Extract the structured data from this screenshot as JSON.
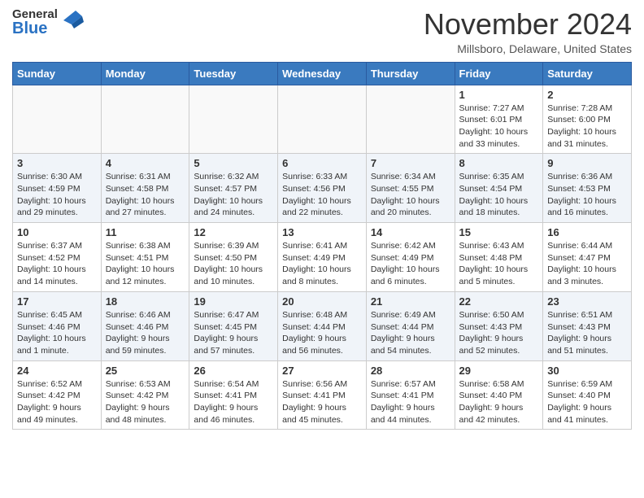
{
  "header": {
    "logo_general": "General",
    "logo_blue": "Blue",
    "month_title": "November 2024",
    "location": "Millsboro, Delaware, United States"
  },
  "days_of_week": [
    "Sunday",
    "Monday",
    "Tuesday",
    "Wednesday",
    "Thursday",
    "Friday",
    "Saturday"
  ],
  "weeks": [
    [
      {
        "day": "",
        "info": ""
      },
      {
        "day": "",
        "info": ""
      },
      {
        "day": "",
        "info": ""
      },
      {
        "day": "",
        "info": ""
      },
      {
        "day": "",
        "info": ""
      },
      {
        "day": "1",
        "info": "Sunrise: 7:27 AM\nSunset: 6:01 PM\nDaylight: 10 hours\nand 33 minutes."
      },
      {
        "day": "2",
        "info": "Sunrise: 7:28 AM\nSunset: 6:00 PM\nDaylight: 10 hours\nand 31 minutes."
      }
    ],
    [
      {
        "day": "3",
        "info": "Sunrise: 6:30 AM\nSunset: 4:59 PM\nDaylight: 10 hours\nand 29 minutes."
      },
      {
        "day": "4",
        "info": "Sunrise: 6:31 AM\nSunset: 4:58 PM\nDaylight: 10 hours\nand 27 minutes."
      },
      {
        "day": "5",
        "info": "Sunrise: 6:32 AM\nSunset: 4:57 PM\nDaylight: 10 hours\nand 24 minutes."
      },
      {
        "day": "6",
        "info": "Sunrise: 6:33 AM\nSunset: 4:56 PM\nDaylight: 10 hours\nand 22 minutes."
      },
      {
        "day": "7",
        "info": "Sunrise: 6:34 AM\nSunset: 4:55 PM\nDaylight: 10 hours\nand 20 minutes."
      },
      {
        "day": "8",
        "info": "Sunrise: 6:35 AM\nSunset: 4:54 PM\nDaylight: 10 hours\nand 18 minutes."
      },
      {
        "day": "9",
        "info": "Sunrise: 6:36 AM\nSunset: 4:53 PM\nDaylight: 10 hours\nand 16 minutes."
      }
    ],
    [
      {
        "day": "10",
        "info": "Sunrise: 6:37 AM\nSunset: 4:52 PM\nDaylight: 10 hours\nand 14 minutes."
      },
      {
        "day": "11",
        "info": "Sunrise: 6:38 AM\nSunset: 4:51 PM\nDaylight: 10 hours\nand 12 minutes."
      },
      {
        "day": "12",
        "info": "Sunrise: 6:39 AM\nSunset: 4:50 PM\nDaylight: 10 hours\nand 10 minutes."
      },
      {
        "day": "13",
        "info": "Sunrise: 6:41 AM\nSunset: 4:49 PM\nDaylight: 10 hours\nand 8 minutes."
      },
      {
        "day": "14",
        "info": "Sunrise: 6:42 AM\nSunset: 4:49 PM\nDaylight: 10 hours\nand 6 minutes."
      },
      {
        "day": "15",
        "info": "Sunrise: 6:43 AM\nSunset: 4:48 PM\nDaylight: 10 hours\nand 5 minutes."
      },
      {
        "day": "16",
        "info": "Sunrise: 6:44 AM\nSunset: 4:47 PM\nDaylight: 10 hours\nand 3 minutes."
      }
    ],
    [
      {
        "day": "17",
        "info": "Sunrise: 6:45 AM\nSunset: 4:46 PM\nDaylight: 10 hours\nand 1 minute."
      },
      {
        "day": "18",
        "info": "Sunrise: 6:46 AM\nSunset: 4:46 PM\nDaylight: 9 hours\nand 59 minutes."
      },
      {
        "day": "19",
        "info": "Sunrise: 6:47 AM\nSunset: 4:45 PM\nDaylight: 9 hours\nand 57 minutes."
      },
      {
        "day": "20",
        "info": "Sunrise: 6:48 AM\nSunset: 4:44 PM\nDaylight: 9 hours\nand 56 minutes."
      },
      {
        "day": "21",
        "info": "Sunrise: 6:49 AM\nSunset: 4:44 PM\nDaylight: 9 hours\nand 54 minutes."
      },
      {
        "day": "22",
        "info": "Sunrise: 6:50 AM\nSunset: 4:43 PM\nDaylight: 9 hours\nand 52 minutes."
      },
      {
        "day": "23",
        "info": "Sunrise: 6:51 AM\nSunset: 4:43 PM\nDaylight: 9 hours\nand 51 minutes."
      }
    ],
    [
      {
        "day": "24",
        "info": "Sunrise: 6:52 AM\nSunset: 4:42 PM\nDaylight: 9 hours\nand 49 minutes."
      },
      {
        "day": "25",
        "info": "Sunrise: 6:53 AM\nSunset: 4:42 PM\nDaylight: 9 hours\nand 48 minutes."
      },
      {
        "day": "26",
        "info": "Sunrise: 6:54 AM\nSunset: 4:41 PM\nDaylight: 9 hours\nand 46 minutes."
      },
      {
        "day": "27",
        "info": "Sunrise: 6:56 AM\nSunset: 4:41 PM\nDaylight: 9 hours\nand 45 minutes."
      },
      {
        "day": "28",
        "info": "Sunrise: 6:57 AM\nSunset: 4:41 PM\nDaylight: 9 hours\nand 44 minutes."
      },
      {
        "day": "29",
        "info": "Sunrise: 6:58 AM\nSunset: 4:40 PM\nDaylight: 9 hours\nand 42 minutes."
      },
      {
        "day": "30",
        "info": "Sunrise: 6:59 AM\nSunset: 4:40 PM\nDaylight: 9 hours\nand 41 minutes."
      }
    ]
  ]
}
